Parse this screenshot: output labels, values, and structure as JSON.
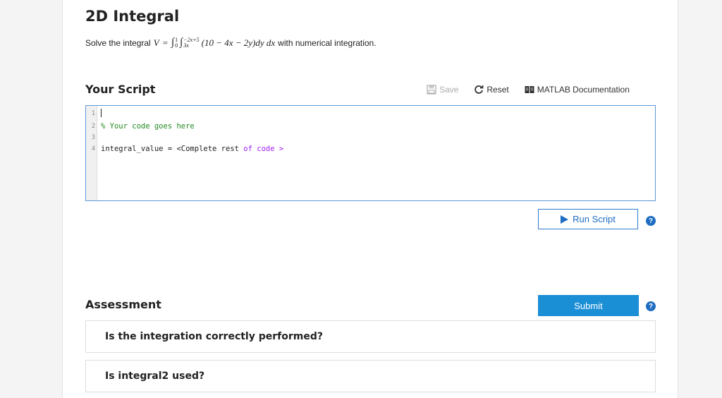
{
  "header": {
    "title": "2D Integral"
  },
  "problem": {
    "prefix": "Solve the integral",
    "V": "V",
    "equals": "=",
    "outer_lower": "0",
    "outer_upper": "1",
    "inner_lower": "3x",
    "inner_upper": "−2x+5",
    "integrand": "(10 − 4x − 2y)dy dx",
    "suffix": "with numerical integration."
  },
  "script_section": {
    "heading": "Your Script",
    "save_label": "Save",
    "reset_label": "Reset",
    "docs_label": "MATLAB Documentation"
  },
  "editor": {
    "lines": [
      {
        "num": "1",
        "text": ""
      },
      {
        "num": "2",
        "text": "% Your code goes here"
      },
      {
        "num": "3",
        "text": ""
      },
      {
        "num": "4",
        "text_a": "integral_value = <Complete rest ",
        "text_kw": "of",
        "text_b": " code >"
      }
    ]
  },
  "run": {
    "label": "Run Script",
    "help": "?"
  },
  "assessment": {
    "heading": "Assessment",
    "submit_label": "Submit",
    "help": "?",
    "items": [
      {
        "text": "Is the integration correctly performed?"
      },
      {
        "text": "Is integral2 used?"
      }
    ]
  },
  "colors": {
    "accent": "#1b8fd6",
    "link": "#1f6dc2",
    "comment": "#228b22",
    "keyword": "#a020f0"
  }
}
